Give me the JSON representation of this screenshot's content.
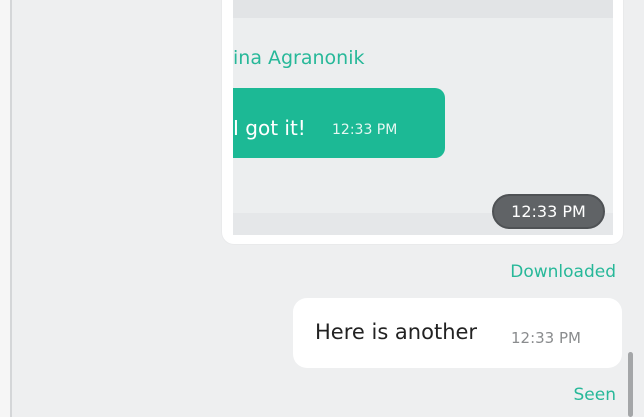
{
  "attachment": {
    "sender_name": "ina Agranonik",
    "message_text": "I got it!",
    "message_time": "12:33 PM",
    "attachment_time": "12:33 PM"
  },
  "status_downloaded": "Downloaded",
  "outgoing_message": {
    "text": "Here is another",
    "time": "12:33 PM"
  },
  "status_seen": "Seen",
  "colors": {
    "accent_green": "#1cb995",
    "status_text": "#27b899",
    "background": "#eeeff0",
    "bubble_white": "#ffffff"
  }
}
